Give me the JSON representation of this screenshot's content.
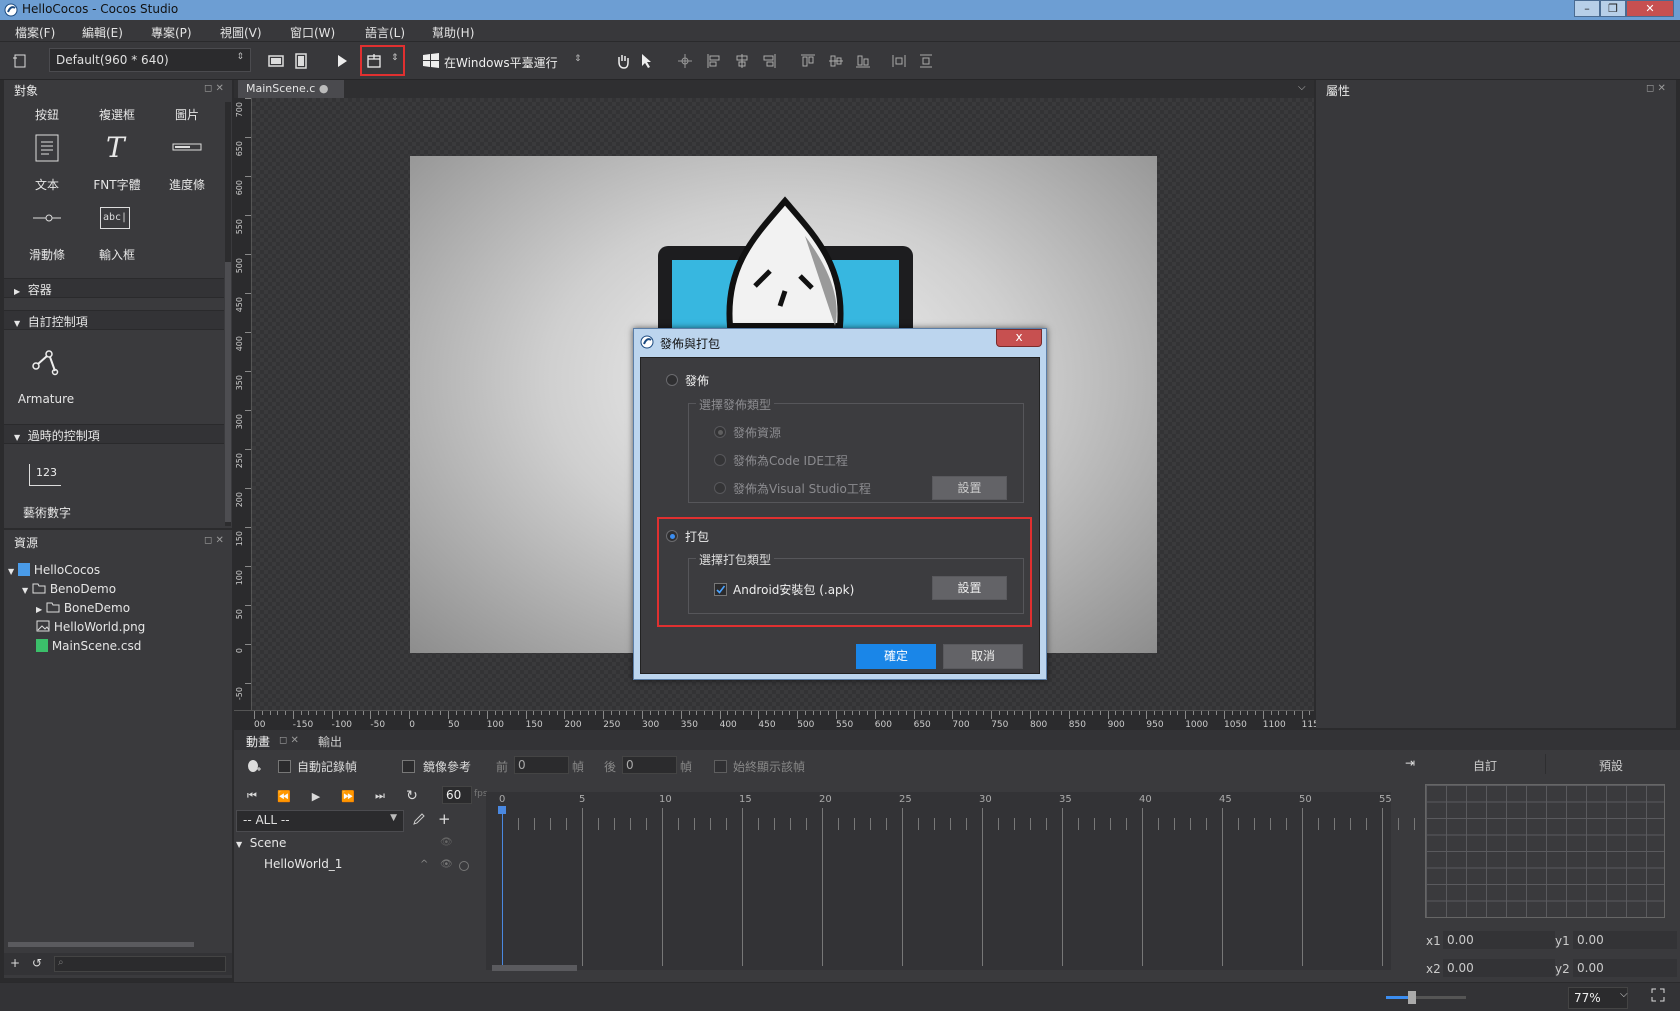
{
  "window": {
    "title": "HelloCocos - Cocos Studio",
    "minimize": "–",
    "restore": "❐",
    "close": "✕"
  },
  "menu": [
    "檔案(F)",
    "編輯(E)",
    "專案(P)",
    "視圖(V)",
    "窗口(W)",
    "語言(L)",
    "幫助(H)"
  ],
  "toolbar": {
    "resolution": "Default(960 * 640)",
    "run_target": "在Windows平臺運行"
  },
  "objects_panel": {
    "title": "對象",
    "row1_labels": [
      "按鈕",
      "複選框",
      "圖片"
    ],
    "row2_labels": [
      "文本",
      "FNT字體",
      "進度條"
    ],
    "row3_labels": [
      "滑動條",
      "輸入框"
    ],
    "input_icon_text": "abc|",
    "containers": "容器",
    "custom_controls": "自訂控制項",
    "armature": "Armature",
    "deprecated_controls": "過時的控制項",
    "atlas_icon_text": "123",
    "atlas_label": "藝術數字"
  },
  "resources_panel": {
    "title": "資源",
    "tree": [
      {
        "label": "HelloCocos",
        "level": 0
      },
      {
        "label": "BenoDemo",
        "level": 1
      },
      {
        "label": "BoneDemo",
        "level": 2
      },
      {
        "label": "HelloWorld.png",
        "level": 2
      },
      {
        "label": "MainScene.csd",
        "level": 2
      }
    ]
  },
  "editor": {
    "tab": "MainScene.c",
    "ruler_x": [
      "00",
      "-150",
      "-100",
      "-50",
      "0",
      "50",
      "100",
      "150",
      "200",
      "250",
      "300",
      "350",
      "400",
      "450",
      "500",
      "550",
      "600",
      "650",
      "700",
      "750",
      "800",
      "850",
      "900",
      "950",
      "1000",
      "1050",
      "1100",
      "115("
    ],
    "ruler_y": [
      "700",
      "650",
      "600",
      "550",
      "500",
      "450",
      "400",
      "350",
      "300",
      "250",
      "200",
      "150",
      "100",
      "50",
      "0",
      "-50"
    ]
  },
  "properties_panel": {
    "title": "屬性"
  },
  "dialog": {
    "title": "發佈與打包",
    "close": "x",
    "publish_label": "發佈",
    "publish_type_group": "選擇發佈類型",
    "publish_options": [
      "發佈資源",
      "發佈為Code IDE工程",
      "發佈為Visual Studio工程"
    ],
    "settings_1": "設置",
    "package_label": "打包",
    "package_type_group": "選擇打包類型",
    "android_option": "Android安裝包 (.apk)",
    "settings_2": "設置",
    "ok": "確定",
    "cancel": "取消"
  },
  "animation_panel": {
    "tab_animation": "動畫",
    "tab_output": "輸出",
    "auto_record": "自動記錄幀",
    "mirror_ref": "鏡像參考",
    "prev_label": "前",
    "prev_value": "0",
    "frame_label": "幀",
    "next_label": "後",
    "next_value": "0",
    "always_show": "始終顯示該幀",
    "fps_value": "60",
    "fps_unit": "fps",
    "filter": "-- ALL --",
    "timeline_marks": [
      "0",
      "5",
      "10",
      "15",
      "20",
      "25",
      "30",
      "35",
      "40",
      "45",
      "50",
      "55"
    ],
    "scene_node": "Scene",
    "child_node": "HelloWorld_1",
    "curve_tab_custom": "自訂",
    "curve_tab_preset": "預設",
    "x1_label": "x1",
    "x1_value": "0.00",
    "y1_label": "y1",
    "y1_value": "0.00",
    "x2_label": "x2",
    "x2_value": "0.00",
    "y2_label": "y2",
    "y2_value": "0.00"
  },
  "status": {
    "zoom": "77%"
  }
}
